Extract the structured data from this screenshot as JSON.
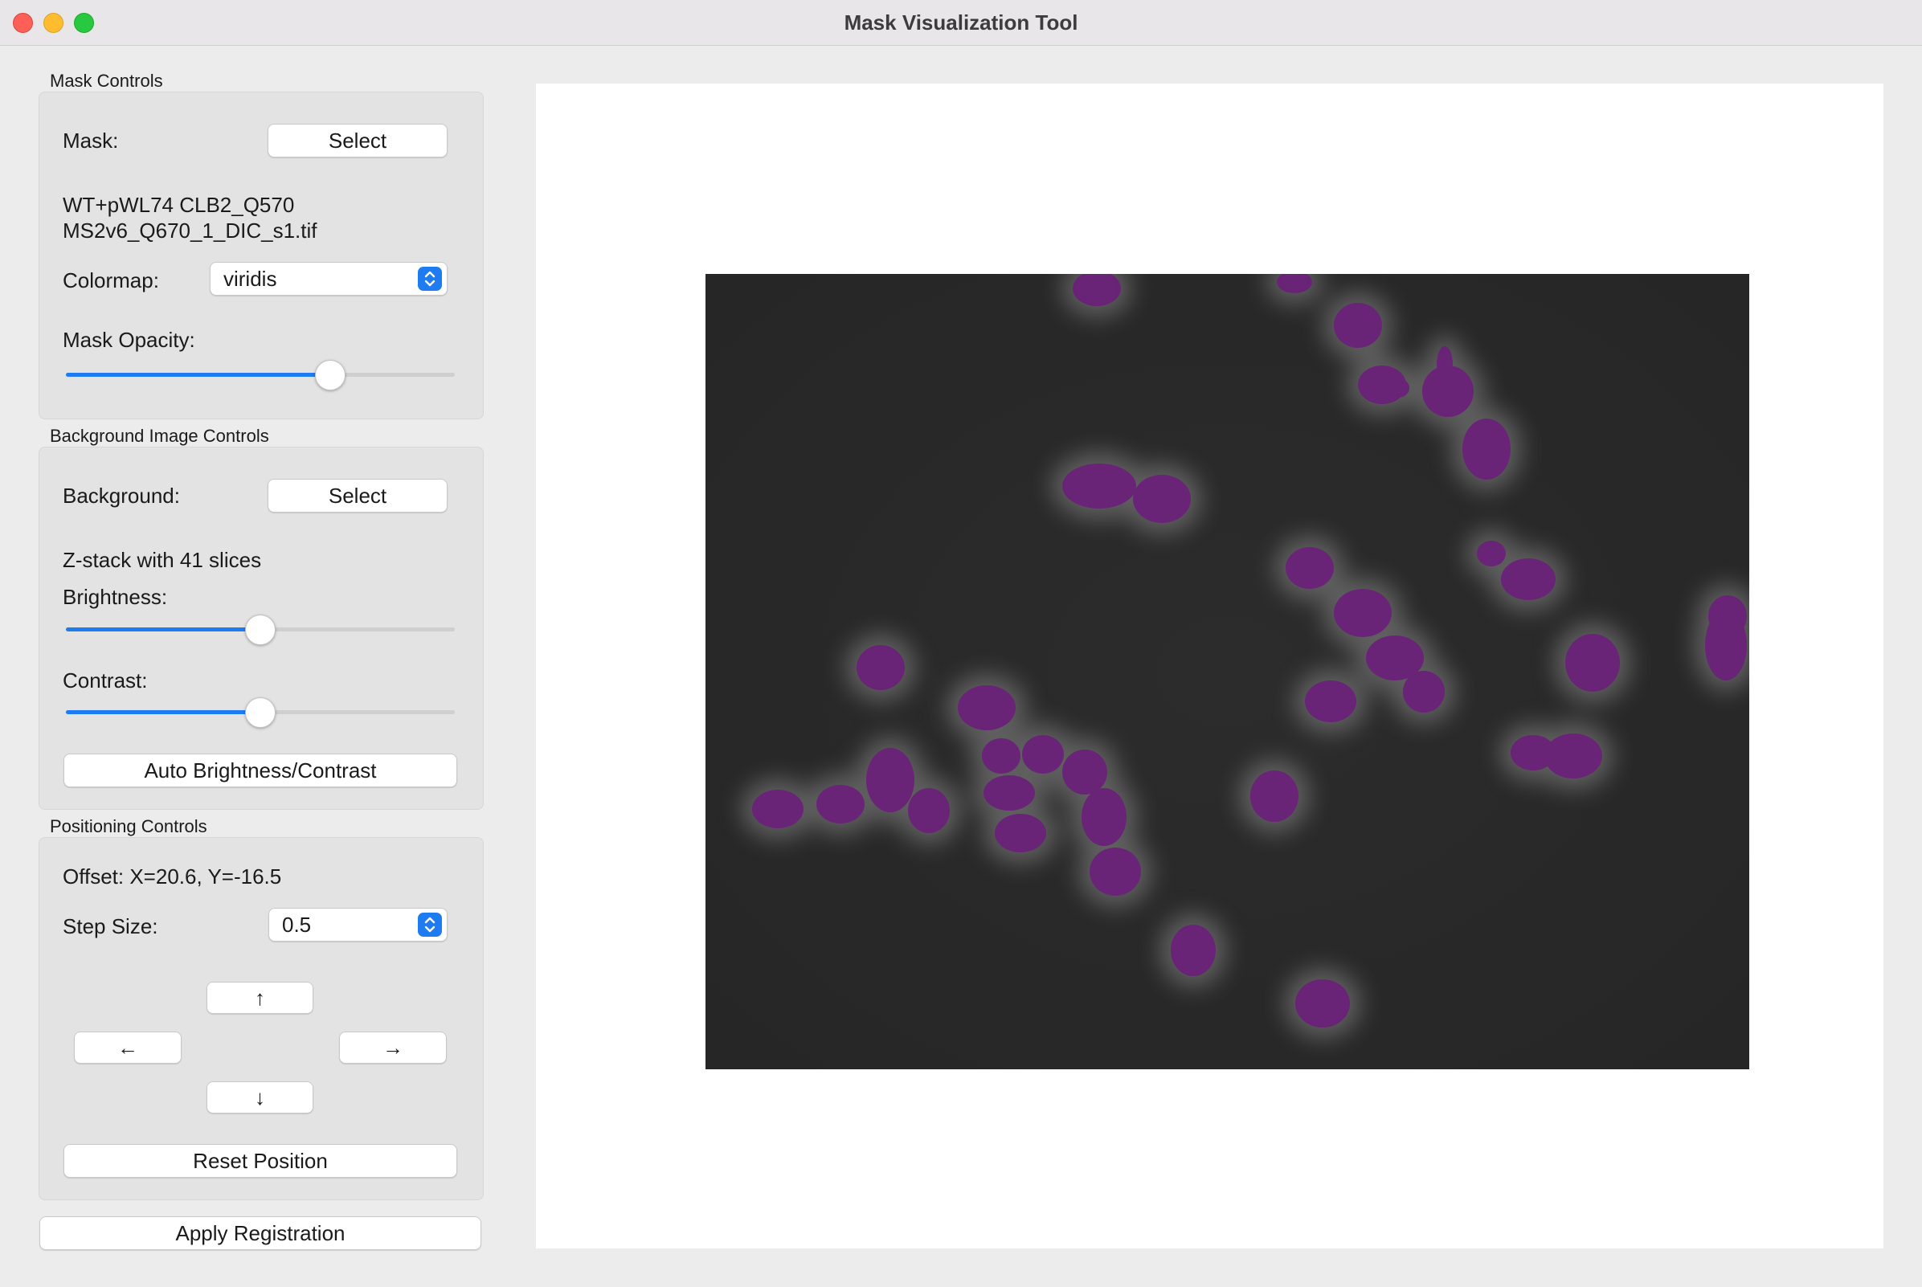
{
  "window": {
    "title": "Mask Visualization Tool"
  },
  "mask_controls": {
    "group_title": "Mask Controls",
    "mask_label": "Mask:",
    "select_label": "Select",
    "filename_line1": "WT+pWL74 CLB2_Q570",
    "filename_line2": "MS2v6_Q670_1_DIC_s1.tif",
    "colormap_label": "Colormap:",
    "colormap_value": "viridis",
    "opacity_label": "Mask Opacity:",
    "opacity_value": 0.68
  },
  "background_controls": {
    "group_title": "Background Image Controls",
    "background_label": "Background:",
    "select_label": "Select",
    "zstack_info": "Z-stack with 41 slices",
    "brightness_label": "Brightness:",
    "brightness_value": 0.5,
    "contrast_label": "Contrast:",
    "contrast_value": 0.5,
    "auto_button_label": "Auto Brightness/Contrast"
  },
  "positioning_controls": {
    "group_title": "Positioning Controls",
    "offset_text": "Offset: X=20.6, Y=-16.5",
    "step_label": "Step Size:",
    "step_value": "0.5",
    "up_arrow": "↑",
    "left_arrow": "←",
    "right_arrow": "→",
    "down_arrow": "↓",
    "reset_label": "Reset Position"
  },
  "apply_button_label": "Apply Registration",
  "colors": {
    "accent": "#1f7cf0",
    "mask_color": "#6b1f7a",
    "micrograph_bg": "#2a2a2a"
  }
}
